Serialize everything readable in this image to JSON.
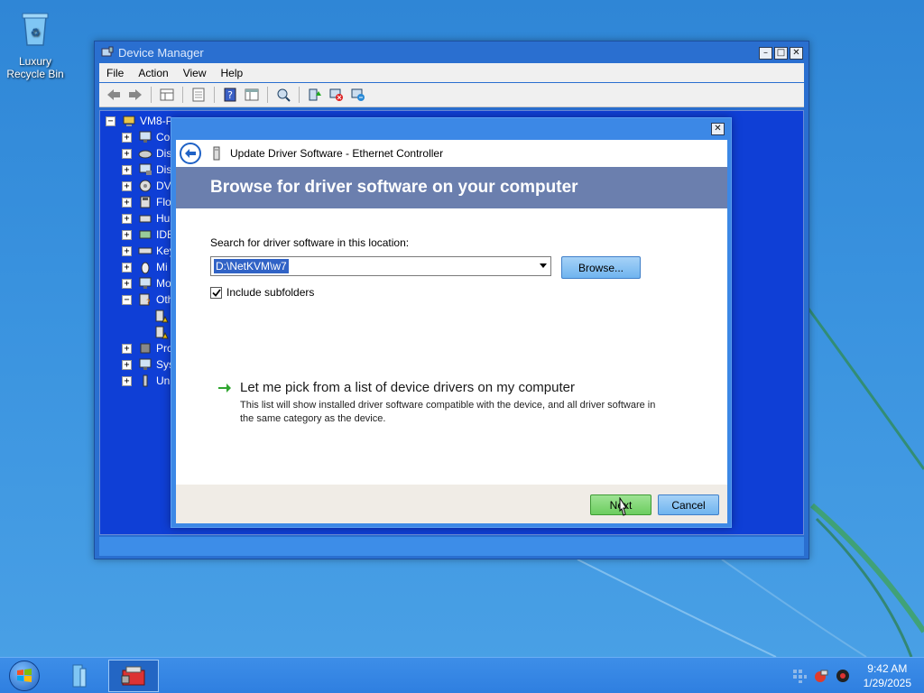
{
  "desktop": {
    "recycle_bin_label": "Luxury Recycle Bin"
  },
  "device_manager": {
    "title": "Device Manager",
    "menu": [
      "File",
      "Action",
      "View",
      "Help"
    ],
    "toolbar_icons": [
      "back-arrow-icon",
      "forward-arrow-icon",
      "properties-grid-icon",
      "show-hide-tree-icon",
      "help-icon",
      "console-tree-icon",
      "scan-hardware-icon",
      "update-driver-icon",
      "uninstall-icon",
      "disable-icon"
    ],
    "tree": {
      "root": "VM8-P",
      "items": [
        {
          "label": "Co",
          "expanded": false
        },
        {
          "label": "Dis",
          "expanded": false
        },
        {
          "label": "Dis",
          "expanded": false
        },
        {
          "label": "DV",
          "expanded": false
        },
        {
          "label": "Flo",
          "expanded": false
        },
        {
          "label": "Hu",
          "expanded": false
        },
        {
          "label": "IDE",
          "expanded": false
        },
        {
          "label": "Key",
          "expanded": false
        },
        {
          "label": "Mi",
          "expanded": false
        },
        {
          "label": "Mo",
          "expanded": false
        },
        {
          "label": "Oth",
          "expanded": true
        },
        {
          "label": "Pro",
          "expanded": false
        },
        {
          "label": "Sys",
          "expanded": false
        },
        {
          "label": "Uni",
          "expanded": false
        }
      ]
    }
  },
  "dialog": {
    "header_title": "Update Driver Software - Ethernet Controller",
    "banner": "Browse for driver software on your computer",
    "search_label": "Search for driver software in this location:",
    "path_value": "D:\\NetKVM\\w7",
    "browse_label": "Browse...",
    "include_subfolders_label": "Include subfolders",
    "include_subfolders_checked": true,
    "pick_link": "Let me pick from a list of device drivers on my computer",
    "pick_desc": "This list will show installed driver software compatible with the device, and all driver software in the same category as the device.",
    "next_label": "Next",
    "cancel_label": "Cancel"
  },
  "taskbar": {
    "time": "9:42 AM",
    "date": "1/29/2025"
  },
  "colors": {
    "desktop_bg": "#3a93df",
    "tree_bg": "#0f3fd6",
    "banner_bg": "#6b7fae",
    "next_btn": "#6ccd5f",
    "cancel_btn": "#6fb4ef"
  }
}
